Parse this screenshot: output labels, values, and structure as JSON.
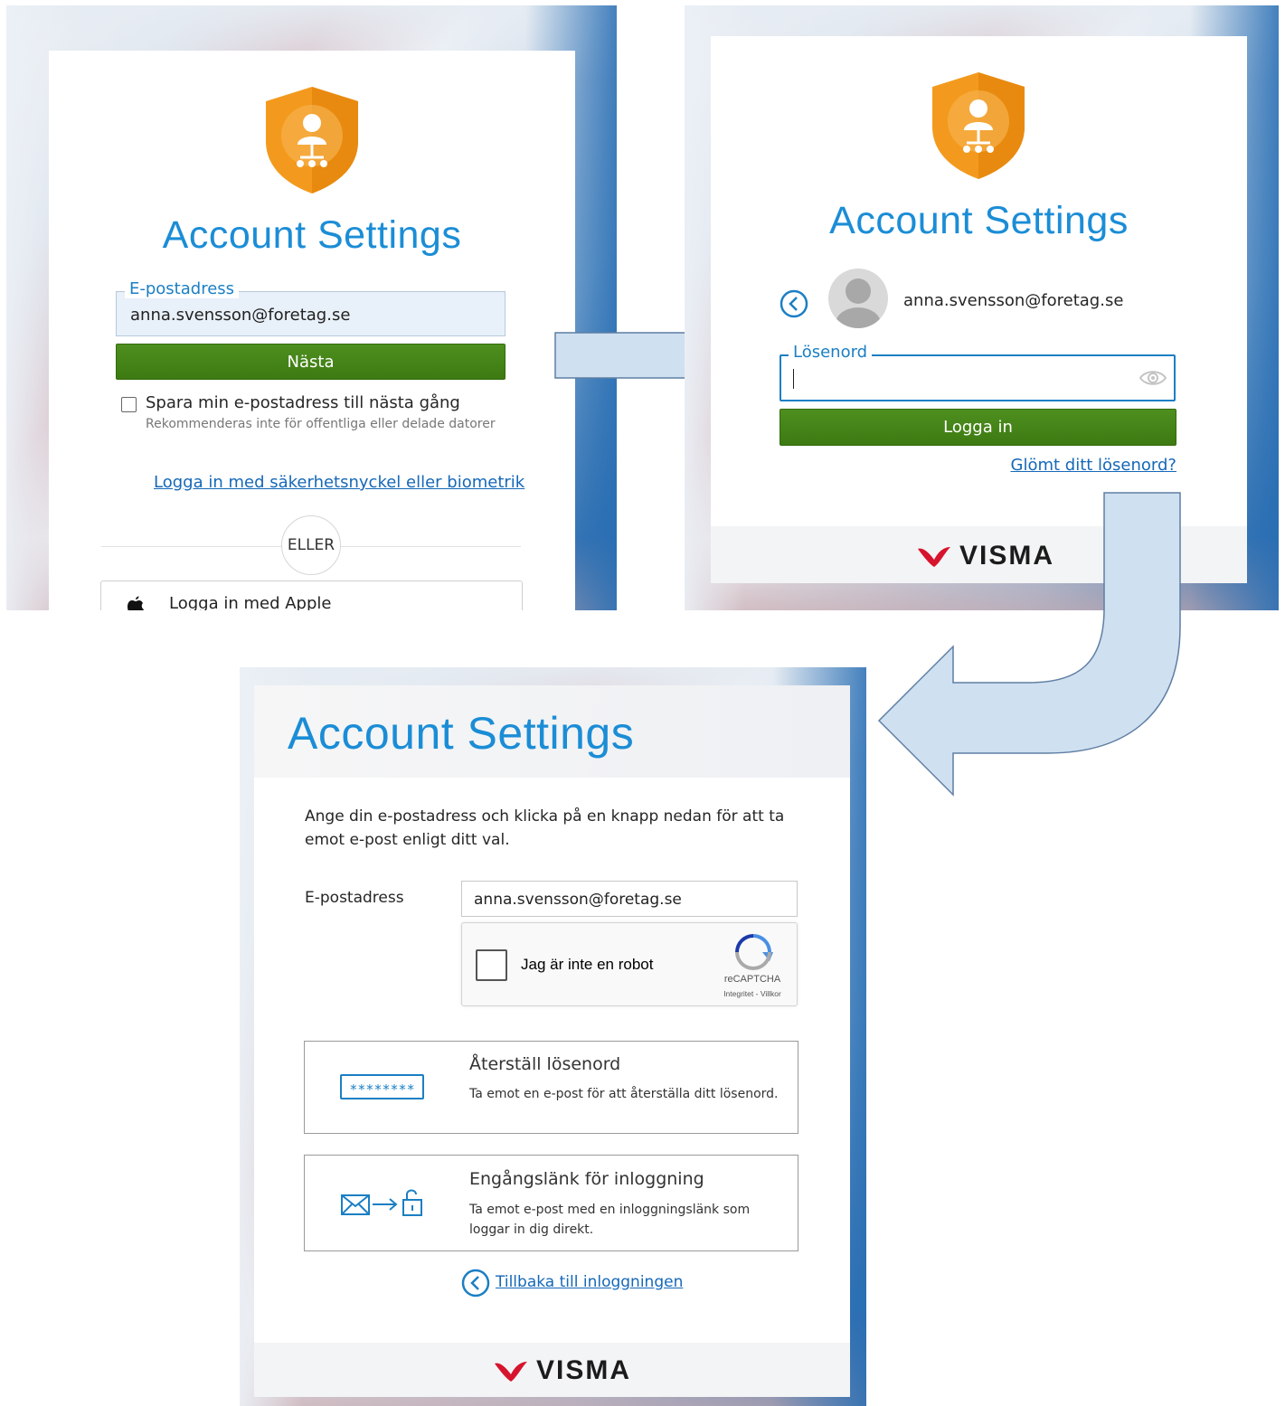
{
  "panel1": {
    "title": "Account Settings",
    "email_legend": "E-postadress",
    "email_value": "anna.svensson@foretag.se",
    "next_button": "Nästa",
    "remember_label": "Spara min e-postadress till nästa gång",
    "remember_hint": "Rekommenderas inte för offentliga eller delade datorer",
    "security_key_link": "Logga in med säkerhetsnyckel eller biometrik",
    "or_divider": "ELLER",
    "apple_button": "Logga in med Apple"
  },
  "panel2": {
    "title": "Account Settings",
    "user_email": "anna.svensson@foretag.se",
    "password_legend": "Lösenord",
    "login_button": "Logga in",
    "forgot_link": "Glömt ditt lösenord?",
    "brand": "VISMA"
  },
  "panel3": {
    "title": "Account Settings",
    "intro_text": "Ange din e-postadress och klicka på en knapp nedan för att ta emot e-post enligt ditt val.",
    "email_label": "E-postadress",
    "email_value": "anna.svensson@foretag.se",
    "captcha": {
      "label": "Jag är inte en robot",
      "brand": "reCAPTCHA",
      "terms": "Integritet - Villkor"
    },
    "reset_option": {
      "title": "Återställ lösenord",
      "description": "Ta emot en e-post för att återställa ditt lösenord.",
      "icon_text": "********"
    },
    "magic_link_option": {
      "title": "Engångslänk för inloggning",
      "description": "Ta emot e-post med en inloggningslänk som loggar in dig direkt."
    },
    "back_link": "Tillbaka till inloggningen",
    "brand": "VISMA"
  },
  "colors": {
    "accent_blue": "#1b8dd6",
    "button_green": "#3d7a12",
    "link_blue": "#1568b8",
    "shield_orange": "#f39a1e",
    "arrow_fill": "#cfe0f1",
    "arrow_stroke": "#5f7fa3",
    "visma_red": "#d7142d"
  },
  "icons": [
    "shield-user-icon",
    "back-circle-icon",
    "avatar-icon",
    "eye-icon",
    "apple-icon",
    "recaptcha-icon",
    "password-field-icon",
    "mail-to-unlock-icon",
    "visma-logo-icon"
  ]
}
